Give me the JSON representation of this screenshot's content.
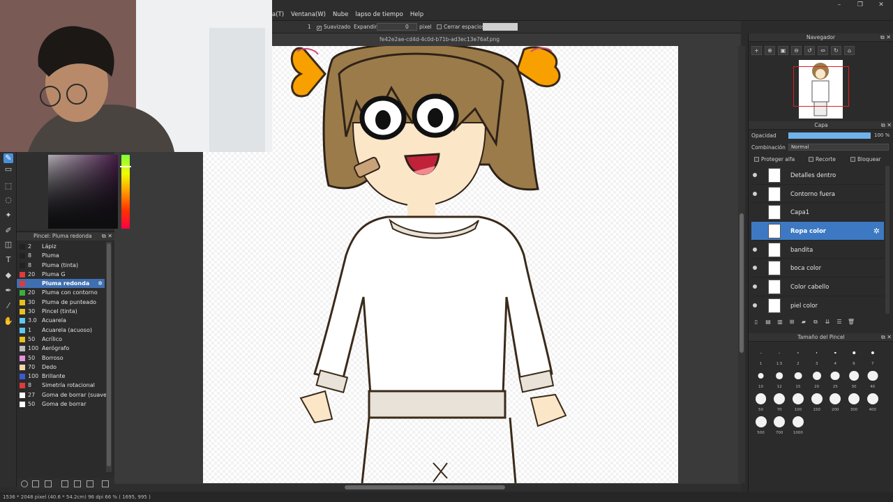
{
  "menubar": {
    "items": [
      "a(T)",
      "Ventana(W)",
      "Nube",
      "lapso de tiempo",
      "Help"
    ],
    "window_controls": [
      "–",
      "❐",
      "✕"
    ]
  },
  "options_bar": {
    "value1": "1",
    "smoothing_label": "Suavizado",
    "expand_label": "Expandir",
    "expand_value": "0",
    "pixel_label": "pixel",
    "close_gaps_label": "Cerrar espacios"
  },
  "canvas": {
    "file_name": "fe42e2ae-cd4d-4c0d-b71b-ad3ec13e76af.png"
  },
  "status_bar": {
    "text": "1536 * 2048 pixel   (40.6 * 54.2cm)   96 dpi   66 %   ( 1695, 995 )"
  },
  "brush_panel": {
    "title": "Pincel: Pluma redonda",
    "items": [
      {
        "size": "2",
        "name": "Lápiz",
        "color": "#222222"
      },
      {
        "size": "8",
        "name": "Pluma",
        "color": "#222222"
      },
      {
        "size": "8",
        "name": "Pluma (tinta)",
        "color": "#222222"
      },
      {
        "size": "20",
        "name": "Pluma G",
        "color": "#e03a3a"
      },
      {
        "size": "",
        "name": "Pluma redonda",
        "color": "#e03a3a",
        "selected": true
      },
      {
        "size": "20",
        "name": "Pluma con contorno",
        "color": "#3ab03a"
      },
      {
        "size": "30",
        "name": "Pluma de punteado",
        "color": "#e8c020"
      },
      {
        "size": "30",
        "name": "Pincel (tinta)",
        "color": "#e8c020"
      },
      {
        "size": "3.0",
        "name": "Acuarela",
        "color": "#5ec8f0"
      },
      {
        "size": "1",
        "name": "Acuarela (acuoso)",
        "color": "#5ec8f0"
      },
      {
        "size": "50",
        "name": "Acrílico",
        "color": "#e8c020"
      },
      {
        "size": "100",
        "name": "Aerógrafo",
        "color": "#bdbdbd"
      },
      {
        "size": "50",
        "name": "Borroso",
        "color": "#e890e0"
      },
      {
        "size": "70",
        "name": "Dedo",
        "color": "#f3d6a8"
      },
      {
        "size": "100",
        "name": "Brillante",
        "color": "#3a5ad0"
      },
      {
        "size": "8",
        "name": "Simetría rotacional",
        "color": "#e03a3a"
      },
      {
        "size": "27",
        "name": "Goma de borrar (suave)",
        "color": "#ffffff"
      },
      {
        "size": "50",
        "name": "Goma de borrar",
        "color": "#ffffff"
      }
    ]
  },
  "navigator": {
    "title": "Navegador"
  },
  "layer_panel": {
    "title": "Capa",
    "opacity_label": "Opacidad",
    "opacity_value": "100 %",
    "opacity_fraction": 1.0,
    "blend_label": "Combinación",
    "blend_value": "Normal",
    "protect_alpha": "Proteger alfa",
    "clipping": "Recorte",
    "lock": "Bloquear",
    "layers": [
      {
        "name": "Detalles dentro",
        "visible": true
      },
      {
        "name": "Contorno fuera",
        "visible": true
      },
      {
        "name": "Capa1",
        "visible": false
      },
      {
        "name": "Ropa color",
        "visible": false,
        "selected": true
      },
      {
        "name": "bandita",
        "visible": true
      },
      {
        "name": "boca color",
        "visible": true
      },
      {
        "name": "Color cabello",
        "visible": true
      },
      {
        "name": "piel color",
        "visible": true
      }
    ]
  },
  "brush_size_panel": {
    "title": "Tamaño del Pincel",
    "sizes": [
      "1",
      "1.5",
      "2",
      "3",
      "4",
      "6",
      "7",
      "10",
      "12",
      "15",
      "20",
      "25",
      "30",
      "40",
      "50",
      "70",
      "100",
      "150",
      "200",
      "300",
      "400",
      "500",
      "700",
      "1000"
    ]
  }
}
